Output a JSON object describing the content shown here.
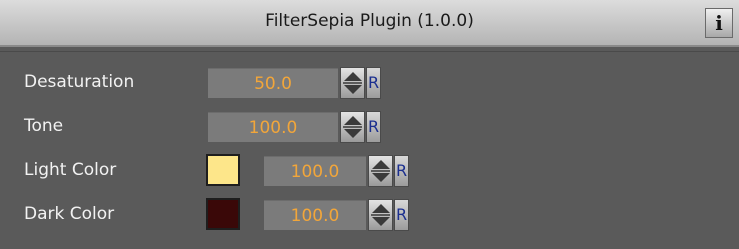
{
  "window": {
    "title": "FilterSepia Plugin (1.0.0)",
    "info_label": "i"
  },
  "params": {
    "desaturation": {
      "label": "Desaturation",
      "value": "50.0",
      "reset_label": "R"
    },
    "tone": {
      "label": "Tone",
      "value": "100.0",
      "reset_label": "R"
    },
    "light_color": {
      "label": "Light Color",
      "value": "100.0",
      "reset_label": "R",
      "swatch_color": "#fde68a"
    },
    "dark_color": {
      "label": "Dark Color",
      "value": "100.0",
      "reset_label": "R",
      "swatch_color": "#3a0808"
    }
  },
  "colors": {
    "value_text": "#f2a63a",
    "panel_bg": "#5a5a5a",
    "reset_text": "#1b2f8f"
  },
  "icons": {
    "info": "info-icon",
    "stepper_up": "arrow-up-icon",
    "stepper_down": "arrow-down-icon"
  }
}
